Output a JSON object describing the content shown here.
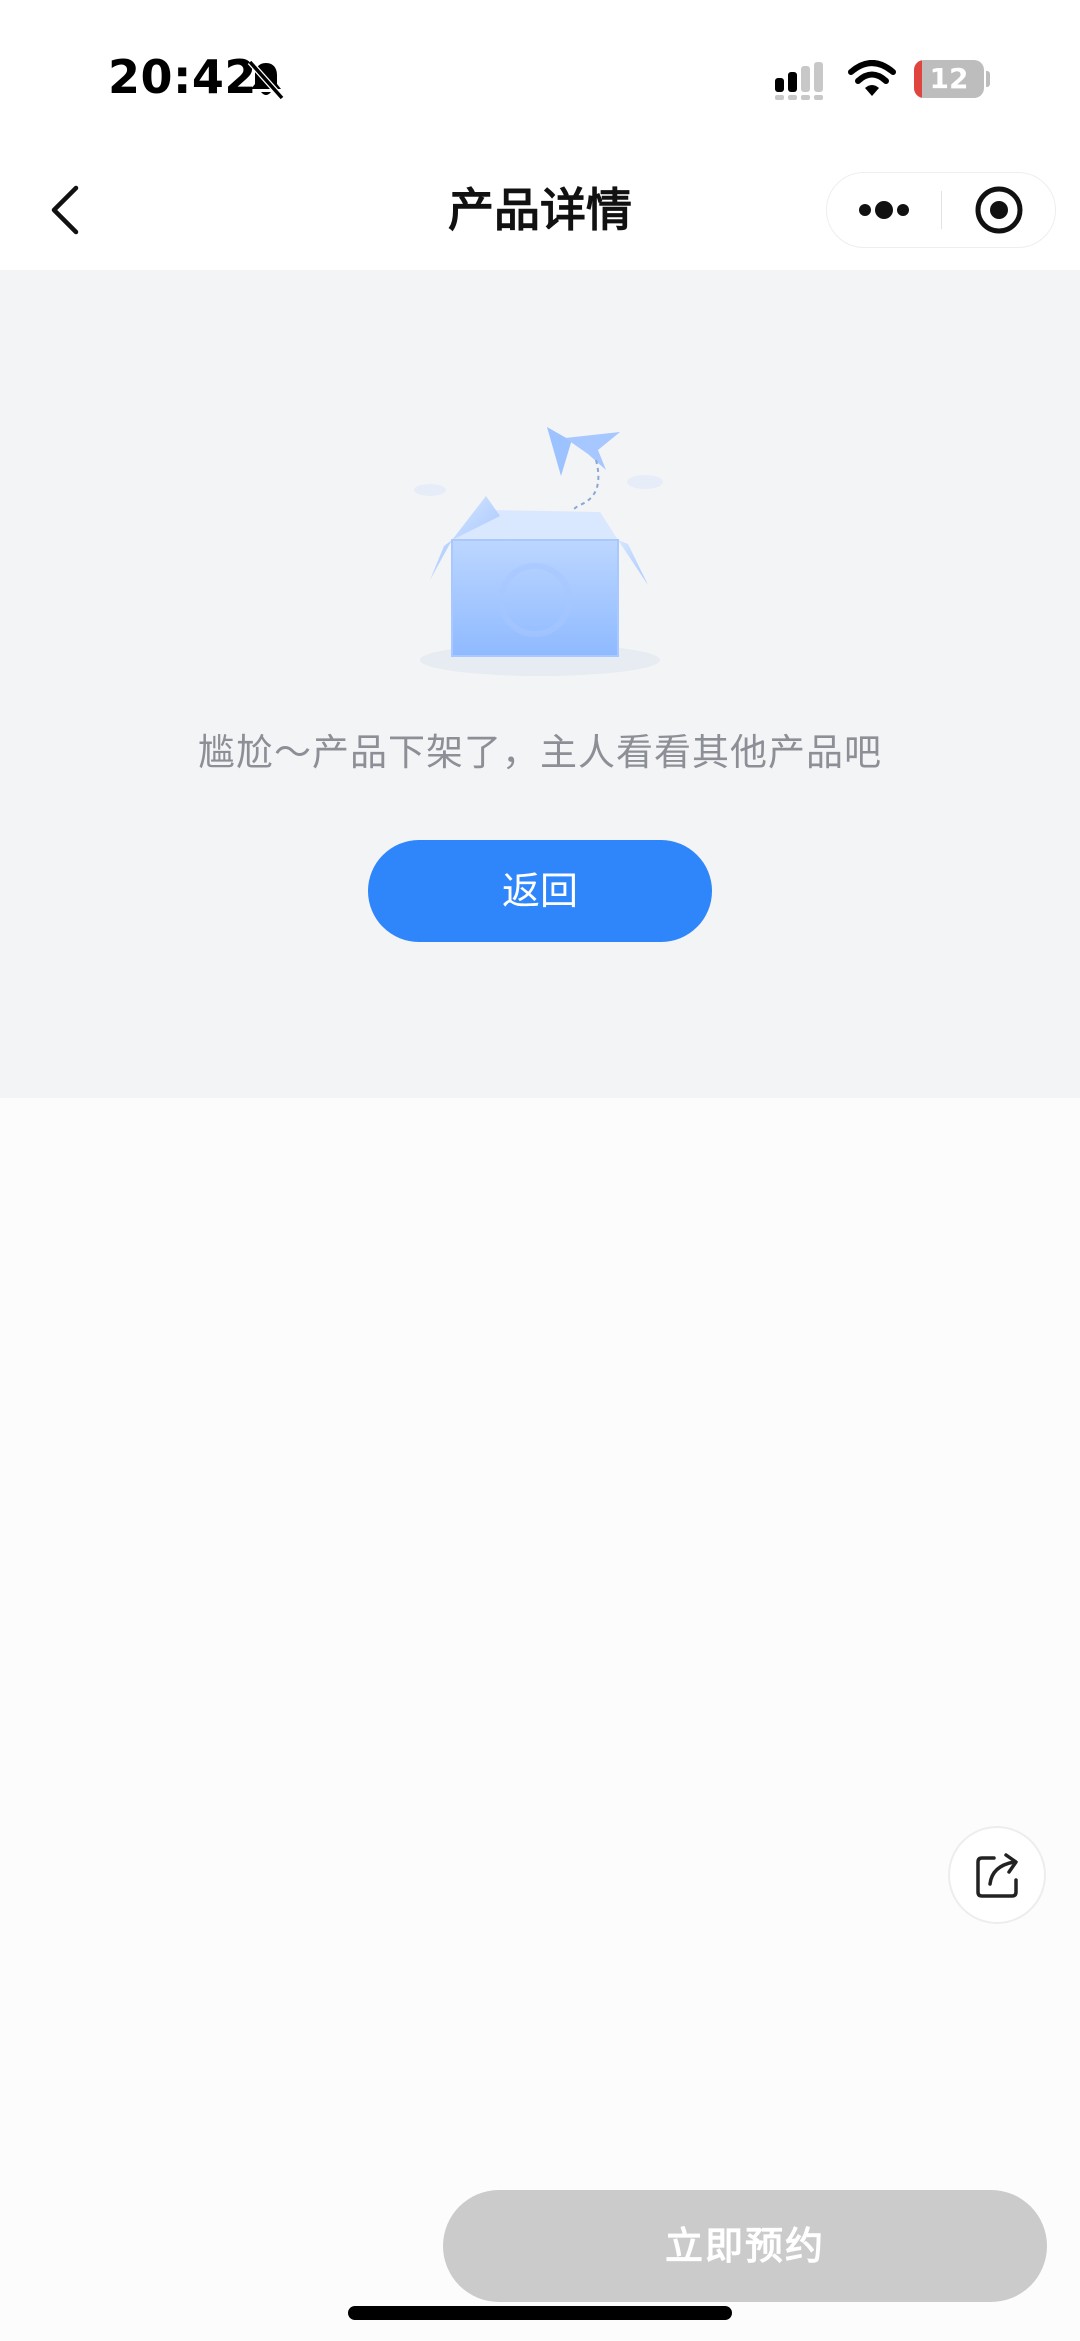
{
  "status_bar": {
    "time": "20:42",
    "battery_level": "12",
    "battery_fraction": 0.12,
    "icons": [
      "bell-muted-icon",
      "signal-icon",
      "wifi-icon",
      "battery-icon"
    ]
  },
  "nav": {
    "title": "产品详情",
    "icons": [
      "chevron-left-icon",
      "more-dots-icon",
      "close-target-icon"
    ]
  },
  "empty_state": {
    "illustration": "empty-box-icon",
    "message": "尴尬～产品下架了，主人看看其他产品吧",
    "return_label": "返回"
  },
  "share": {
    "icon": "share-icon"
  },
  "bottom": {
    "book_label": "立即预约"
  },
  "colors": {
    "accent": "#2f86fb",
    "empty_bg": "#f3f4f6",
    "disabled_button": "#cbcbcb",
    "battery_low": "#e0443e"
  }
}
